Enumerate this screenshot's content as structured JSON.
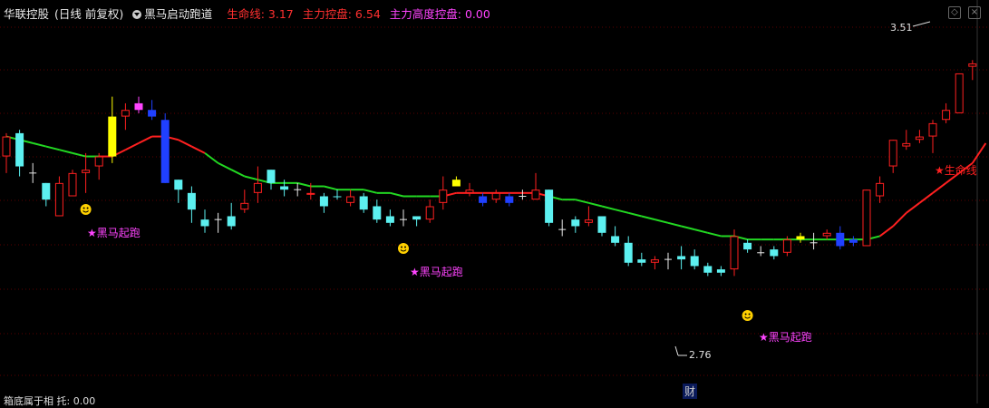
{
  "header": {
    "stock": "华联控股",
    "period": "(日线 前复权)",
    "indicator": "黑马启动跑道",
    "lifeline": "生命线: 3.17",
    "control": "主力控盘: 6.54",
    "high_control": "主力高度控盘: 0.00"
  },
  "bottom_text": "箱底属于相 托: 0.00",
  "fin_marker": "财",
  "colors": {
    "bg": "#000000",
    "grid": "#5a0000",
    "up": "#ff2020",
    "down": "#5cf0f0",
    "lifeline_up": "#ff2020",
    "lifeline_down": "#22d822",
    "blue": "#2040ff",
    "yellow": "#ffff00",
    "magenta": "#ff44ff"
  },
  "chart_data": {
    "type": "candlestick",
    "y_range": [
      2.55,
      3.62
    ],
    "high_label": "3.51",
    "low_label": "2.76",
    "line_label": "★生命线",
    "signal_label": "★黑马起跑",
    "candles": [
      {
        "o": 3.22,
        "c": 3.28,
        "h": 3.29,
        "l": 3.17,
        "k": "up"
      },
      {
        "o": 3.29,
        "c": 3.19,
        "h": 3.3,
        "l": 3.16,
        "k": "down"
      },
      {
        "o": 3.17,
        "c": 3.17,
        "h": 3.2,
        "l": 3.14,
        "k": "doji"
      },
      {
        "o": 3.09,
        "c": 3.14,
        "h": 3.14,
        "l": 3.07,
        "k": "down"
      },
      {
        "o": 3.14,
        "c": 3.04,
        "h": 3.16,
        "l": 3.04,
        "k": "up"
      },
      {
        "o": 3.1,
        "c": 3.17,
        "h": 3.18,
        "l": 3.1,
        "k": "up"
      },
      {
        "o": 3.17,
        "c": 3.18,
        "h": 3.23,
        "l": 3.11,
        "k": "up"
      },
      {
        "o": 3.19,
        "c": 3.22,
        "h": 3.23,
        "l": 3.15,
        "k": "up"
      },
      {
        "o": 3.22,
        "c": 3.34,
        "h": 3.4,
        "l": 3.2,
        "k": "yellow"
      },
      {
        "o": 3.34,
        "c": 3.36,
        "h": 3.38,
        "l": 3.3,
        "k": "up"
      },
      {
        "o": 3.36,
        "c": 3.38,
        "h": 3.4,
        "l": 3.35,
        "k": "magenta"
      },
      {
        "o": 3.36,
        "c": 3.34,
        "h": 3.39,
        "l": 3.33,
        "k": "blue"
      },
      {
        "o": 3.33,
        "c": 3.14,
        "h": 3.35,
        "l": 3.14,
        "k": "blue"
      },
      {
        "o": 3.15,
        "c": 3.12,
        "h": 3.15,
        "l": 3.08,
        "k": "down"
      },
      {
        "o": 3.11,
        "c": 3.06,
        "h": 3.13,
        "l": 3.02,
        "k": "down"
      },
      {
        "o": 3.03,
        "c": 3.01,
        "h": 3.06,
        "l": 2.99,
        "k": "down"
      },
      {
        "o": 3.03,
        "c": 3.03,
        "h": 3.05,
        "l": 2.99,
        "k": "doji"
      },
      {
        "o": 3.01,
        "c": 3.04,
        "h": 3.08,
        "l": 3.0,
        "k": "down"
      },
      {
        "o": 3.06,
        "c": 3.08,
        "h": 3.12,
        "l": 3.05,
        "k": "up"
      },
      {
        "o": 3.11,
        "c": 3.14,
        "h": 3.19,
        "l": 3.08,
        "k": "up"
      },
      {
        "o": 3.18,
        "c": 3.14,
        "h": 3.18,
        "l": 3.12,
        "k": "down"
      },
      {
        "o": 3.13,
        "c": 3.12,
        "h": 3.15,
        "l": 3.1,
        "k": "down"
      },
      {
        "o": 3.12,
        "c": 3.12,
        "h": 3.14,
        "l": 3.1,
        "k": "doji"
      },
      {
        "o": 3.11,
        "c": 3.11,
        "h": 3.14,
        "l": 3.09,
        "k": "up"
      },
      {
        "o": 3.1,
        "c": 3.07,
        "h": 3.11,
        "l": 3.05,
        "k": "down"
      },
      {
        "o": 3.1,
        "c": 3.1,
        "h": 3.12,
        "l": 3.09,
        "k": "down"
      },
      {
        "o": 3.08,
        "c": 3.1,
        "h": 3.12,
        "l": 3.07,
        "k": "up"
      },
      {
        "o": 3.1,
        "c": 3.06,
        "h": 3.11,
        "l": 3.05,
        "k": "down"
      },
      {
        "o": 3.07,
        "c": 3.03,
        "h": 3.09,
        "l": 3.02,
        "k": "down"
      },
      {
        "o": 3.04,
        "c": 3.02,
        "h": 3.06,
        "l": 3.01,
        "k": "down"
      },
      {
        "o": 3.03,
        "c": 3.03,
        "h": 3.06,
        "l": 3.01,
        "k": "doji"
      },
      {
        "o": 3.04,
        "c": 3.03,
        "h": 3.04,
        "l": 3.01,
        "k": "down"
      },
      {
        "o": 3.03,
        "c": 3.07,
        "h": 3.09,
        "l": 3.02,
        "k": "up"
      },
      {
        "o": 3.08,
        "c": 3.12,
        "h": 3.16,
        "l": 3.06,
        "k": "up"
      },
      {
        "o": 3.15,
        "c": 3.13,
        "h": 3.16,
        "l": 3.13,
        "k": "yellow"
      },
      {
        "o": 3.11,
        "c": 3.12,
        "h": 3.14,
        "l": 3.1,
        "k": "up"
      },
      {
        "o": 3.1,
        "c": 3.08,
        "h": 3.11,
        "l": 3.07,
        "k": "blue"
      },
      {
        "o": 3.09,
        "c": 3.11,
        "h": 3.12,
        "l": 3.08,
        "k": "up"
      },
      {
        "o": 3.08,
        "c": 3.1,
        "h": 3.11,
        "l": 3.07,
        "k": "blue"
      },
      {
        "o": 3.1,
        "c": 3.1,
        "h": 3.12,
        "l": 3.09,
        "k": "doji"
      },
      {
        "o": 3.09,
        "c": 3.12,
        "h": 3.17,
        "l": 3.09,
        "k": "up"
      },
      {
        "o": 3.12,
        "c": 3.02,
        "h": 3.12,
        "l": 3.01,
        "k": "down"
      },
      {
        "o": 3.0,
        "c": 3.0,
        "h": 3.03,
        "l": 2.98,
        "k": "doji"
      },
      {
        "o": 3.01,
        "c": 3.03,
        "h": 3.04,
        "l": 2.99,
        "k": "down"
      },
      {
        "o": 3.02,
        "c": 3.03,
        "h": 3.07,
        "l": 3.01,
        "k": "up"
      },
      {
        "o": 3.04,
        "c": 2.99,
        "h": 3.04,
        "l": 2.98,
        "k": "down"
      },
      {
        "o": 2.98,
        "c": 2.96,
        "h": 3.01,
        "l": 2.95,
        "k": "down"
      },
      {
        "o": 2.96,
        "c": 2.9,
        "h": 2.98,
        "l": 2.89,
        "k": "down"
      },
      {
        "o": 2.91,
        "c": 2.9,
        "h": 2.93,
        "l": 2.89,
        "k": "down"
      },
      {
        "o": 2.9,
        "c": 2.91,
        "h": 2.92,
        "l": 2.88,
        "k": "up"
      },
      {
        "o": 2.91,
        "c": 2.91,
        "h": 2.93,
        "l": 2.88,
        "k": "doji"
      },
      {
        "o": 2.92,
        "c": 2.91,
        "h": 2.95,
        "l": 2.88,
        "k": "down"
      },
      {
        "o": 2.92,
        "c": 2.89,
        "h": 2.94,
        "l": 2.88,
        "k": "down"
      },
      {
        "o": 2.89,
        "c": 2.87,
        "h": 2.9,
        "l": 2.86,
        "k": "down"
      },
      {
        "o": 2.88,
        "c": 2.87,
        "h": 2.89,
        "l": 2.86,
        "k": "down"
      },
      {
        "o": 2.88,
        "c": 2.98,
        "h": 3.0,
        "l": 2.86,
        "k": "up"
      },
      {
        "o": 2.96,
        "c": 2.94,
        "h": 2.97,
        "l": 2.93,
        "k": "down"
      },
      {
        "o": 2.93,
        "c": 2.93,
        "h": 2.95,
        "l": 2.92,
        "k": "doji"
      },
      {
        "o": 2.94,
        "c": 2.92,
        "h": 2.95,
        "l": 2.91,
        "k": "down"
      },
      {
        "o": 2.93,
        "c": 2.97,
        "h": 2.98,
        "l": 2.92,
        "k": "up"
      },
      {
        "o": 2.97,
        "c": 2.98,
        "h": 2.99,
        "l": 2.96,
        "k": "yellow"
      },
      {
        "o": 2.96,
        "c": 2.96,
        "h": 2.99,
        "l": 2.94,
        "k": "doji"
      },
      {
        "o": 2.99,
        "c": 2.98,
        "h": 3.0,
        "l": 2.97,
        "k": "up"
      },
      {
        "o": 2.99,
        "c": 2.95,
        "h": 3.01,
        "l": 2.94,
        "k": "blue"
      },
      {
        "o": 2.97,
        "c": 2.96,
        "h": 2.98,
        "l": 2.95,
        "k": "blue"
      },
      {
        "o": 2.95,
        "c": 3.12,
        "h": 3.12,
        "l": 2.95,
        "k": "up"
      },
      {
        "o": 3.1,
        "c": 3.14,
        "h": 3.16,
        "l": 3.08,
        "k": "up"
      },
      {
        "o": 3.19,
        "c": 3.27,
        "h": 3.27,
        "l": 3.17,
        "k": "up"
      },
      {
        "o": 3.25,
        "c": 3.26,
        "h": 3.3,
        "l": 3.24,
        "k": "up"
      },
      {
        "o": 3.27,
        "c": 3.28,
        "h": 3.3,
        "l": 3.26,
        "k": "up"
      },
      {
        "o": 3.28,
        "c": 3.32,
        "h": 3.33,
        "l": 3.23,
        "k": "up"
      },
      {
        "o": 3.33,
        "c": 3.36,
        "h": 3.38,
        "l": 3.32,
        "k": "up"
      },
      {
        "o": 3.35,
        "c": 3.47,
        "h": 3.47,
        "l": 3.35,
        "k": "up"
      },
      {
        "o": 3.49,
        "c": 3.5,
        "h": 3.51,
        "l": 3.45,
        "k": "up"
      }
    ],
    "lifeline": [
      3.28,
      3.27,
      3.26,
      3.25,
      3.24,
      3.23,
      3.22,
      3.22,
      3.22,
      3.24,
      3.26,
      3.28,
      3.28,
      3.27,
      3.25,
      3.23,
      3.2,
      3.18,
      3.16,
      3.15,
      3.14,
      3.14,
      3.14,
      3.13,
      3.13,
      3.12,
      3.12,
      3.12,
      3.11,
      3.11,
      3.1,
      3.1,
      3.1,
      3.1,
      3.11,
      3.11,
      3.11,
      3.11,
      3.11,
      3.11,
      3.11,
      3.1,
      3.09,
      3.09,
      3.08,
      3.07,
      3.06,
      3.05,
      3.04,
      3.03,
      3.02,
      3.01,
      3.0,
      2.99,
      2.98,
      2.98,
      2.97,
      2.97,
      2.97,
      2.97,
      2.97,
      2.97,
      2.97,
      2.97,
      2.97,
      2.97,
      2.98,
      3.01,
      3.05,
      3.08,
      3.11,
      3.14,
      3.17,
      3.2,
      3.26
    ],
    "lifeline_colors": "gggggggrrrrrrrrggggggggggggggggggrrrrrrrrgggggggggggggggggggggggggrrrrrrrrrr"
  }
}
